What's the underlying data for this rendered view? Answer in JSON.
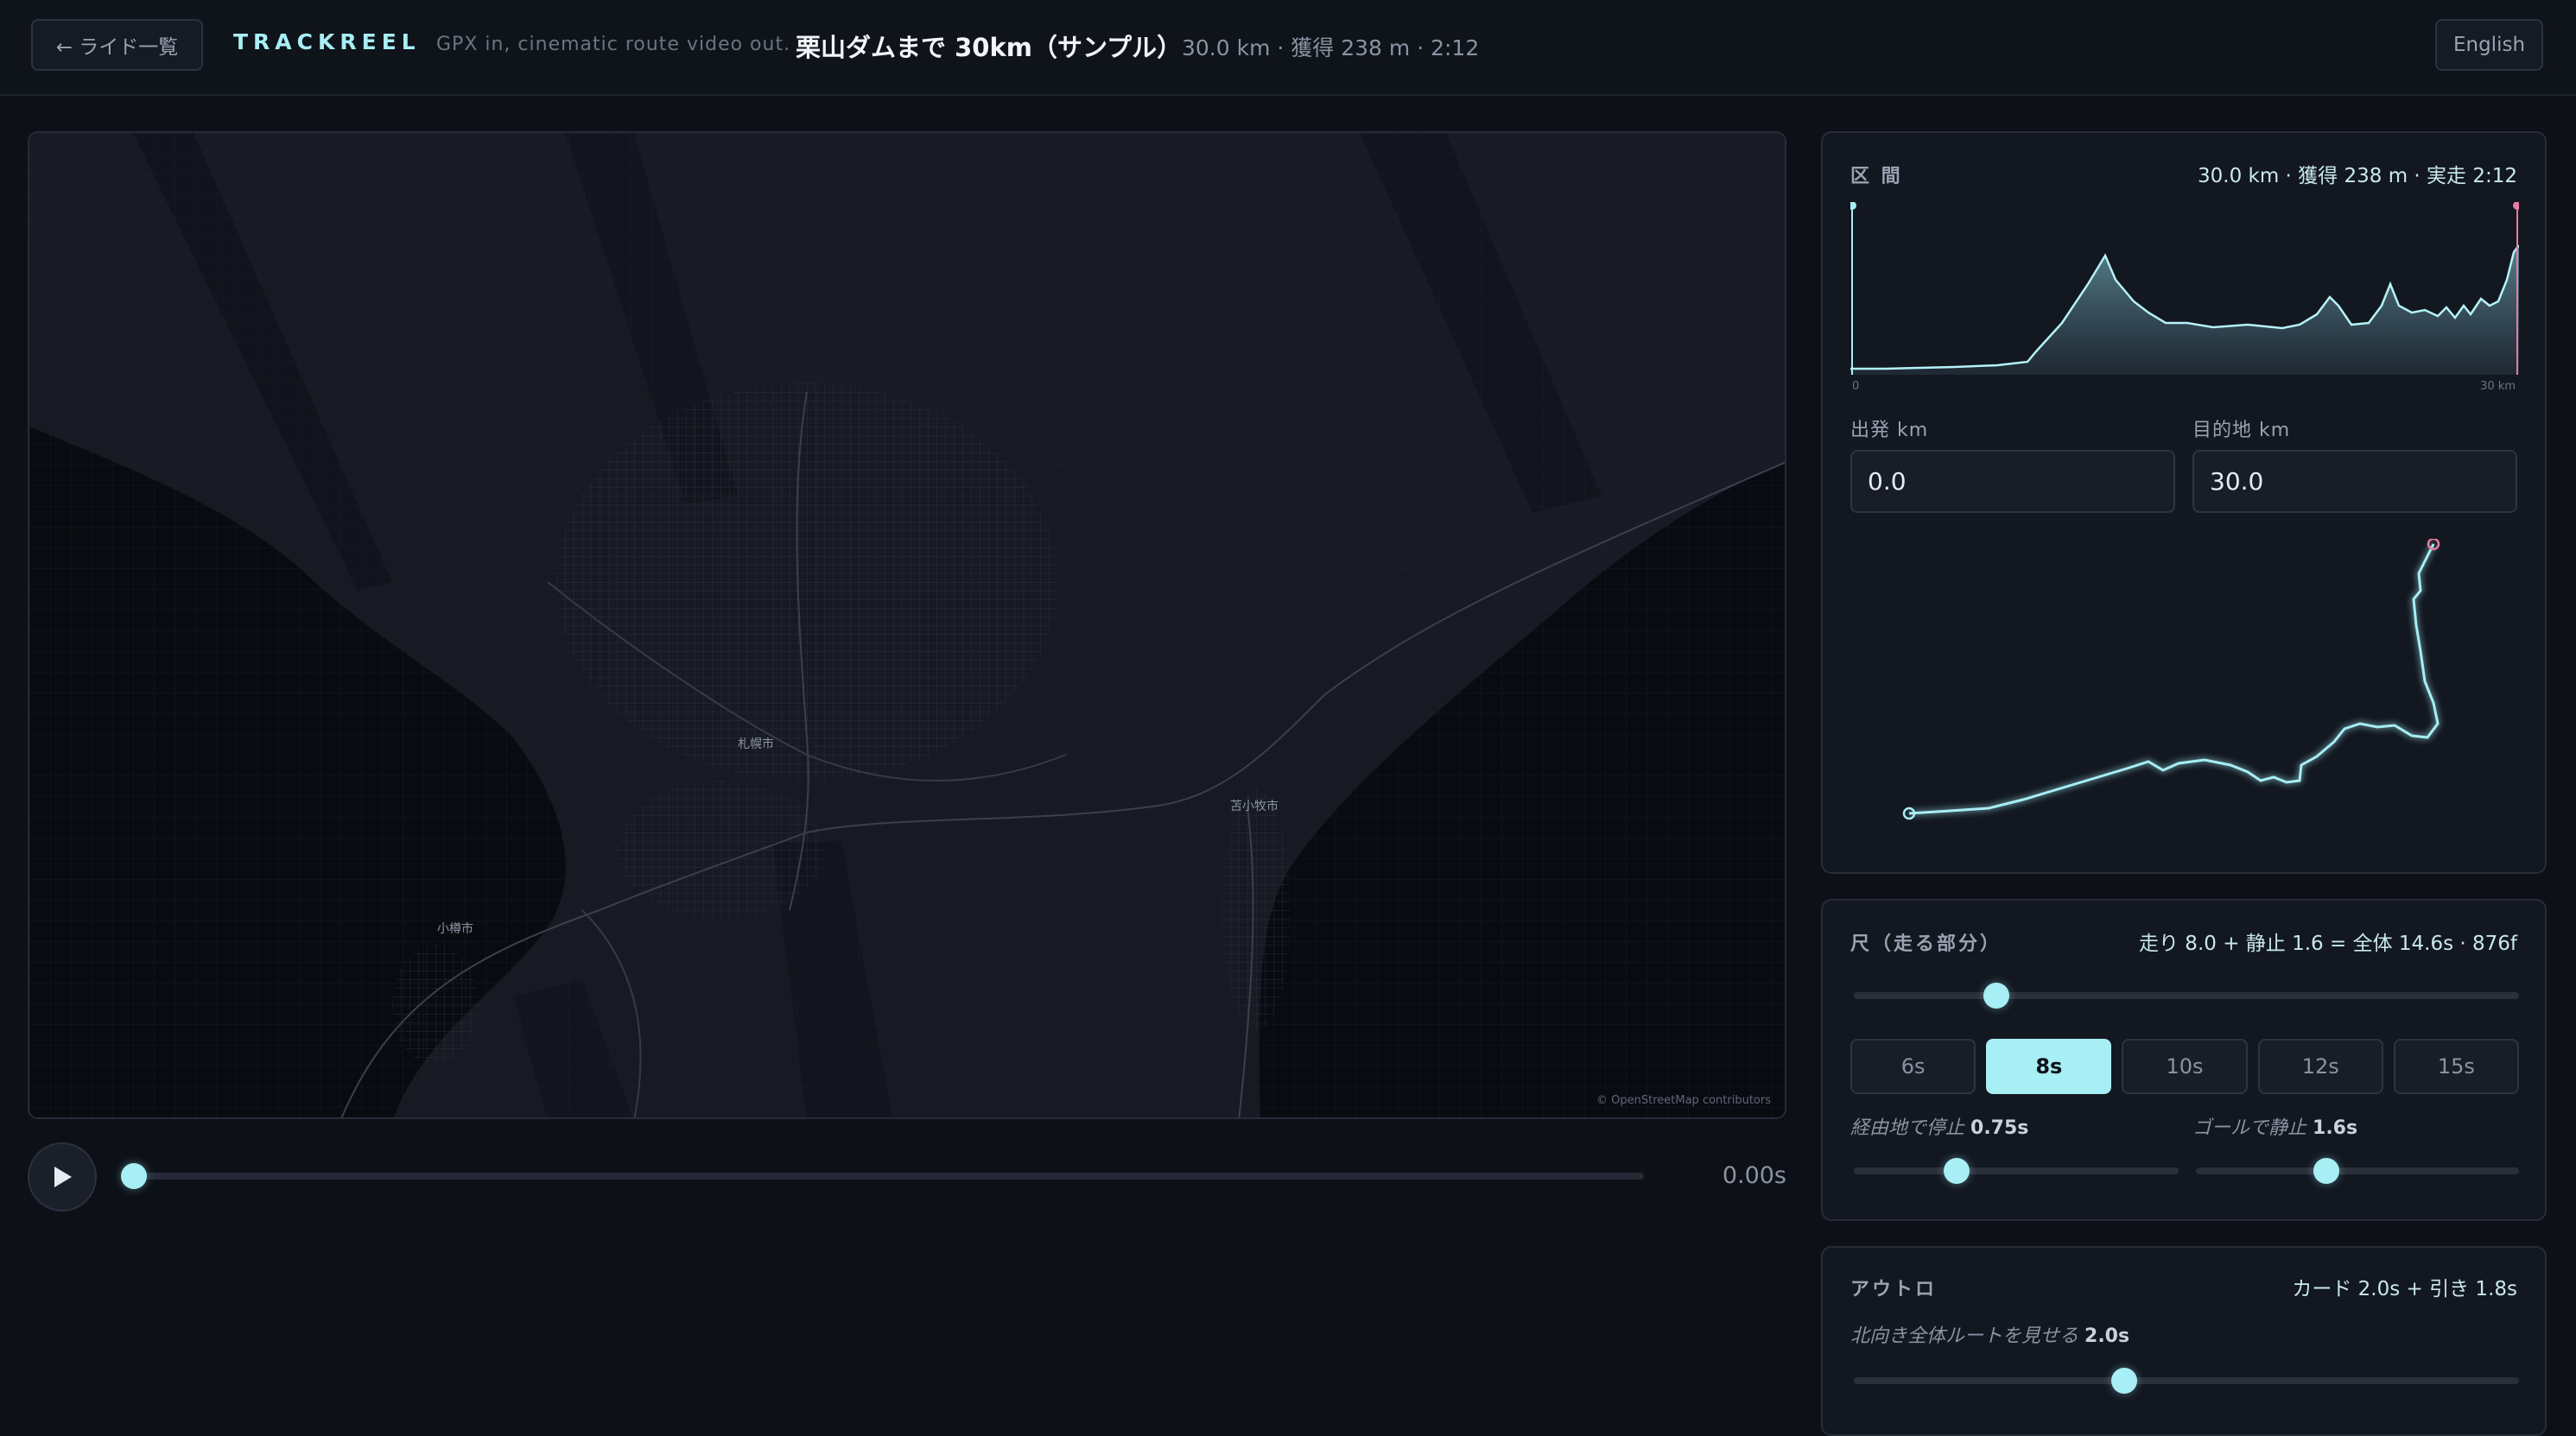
{
  "header": {
    "back_label": "← ライド一覧",
    "brand": "TRACKREEL",
    "tagline": "GPX in, cinematic route video out.",
    "ride_title": "栗山ダムまで 30km（サンプル）",
    "ride_stats": "30.0 km · 獲得 238 m · 2:12",
    "language_label": "English"
  },
  "map": {
    "labels": {
      "sapporo": "札幌市",
      "tomakomai": "苫小牧市",
      "otaru": "小樽市"
    },
    "attribution": "© OpenStreetMap contributors"
  },
  "player": {
    "time": "0.00s",
    "progress": 0
  },
  "segment": {
    "label": "区 間",
    "summary": "30.0 km · 獲得 238 m · 実走 2:12",
    "axis_start": "0",
    "axis_end": "30 km",
    "start_label": "出発 km",
    "start_value": "0.0",
    "end_label": "目的地 km",
    "end_value": "30.0"
  },
  "scale": {
    "label": "尺（走る部分）",
    "summary": "走り 8.0 + 静止 1.6 = 全体 14.6s · 876f",
    "run_value": 8.0,
    "options": [
      "6s",
      "8s",
      "10s",
      "12s",
      "15s"
    ],
    "selected": "8s",
    "waypoint_stop_label": "経由地で停止",
    "waypoint_stop_value": "0.75s",
    "goal_stop_label": "ゴールで静止",
    "goal_stop_value": "1.6s"
  },
  "outro": {
    "label": "アウトロ",
    "summary": "カード 2.0s + 引き 1.8s",
    "north_label": "北向き全体ルートを見せる",
    "north_value": "2.0s"
  },
  "colors": {
    "accent": "#a7eef5",
    "end_marker": "#e87ba1",
    "background": "#0d1017"
  }
}
